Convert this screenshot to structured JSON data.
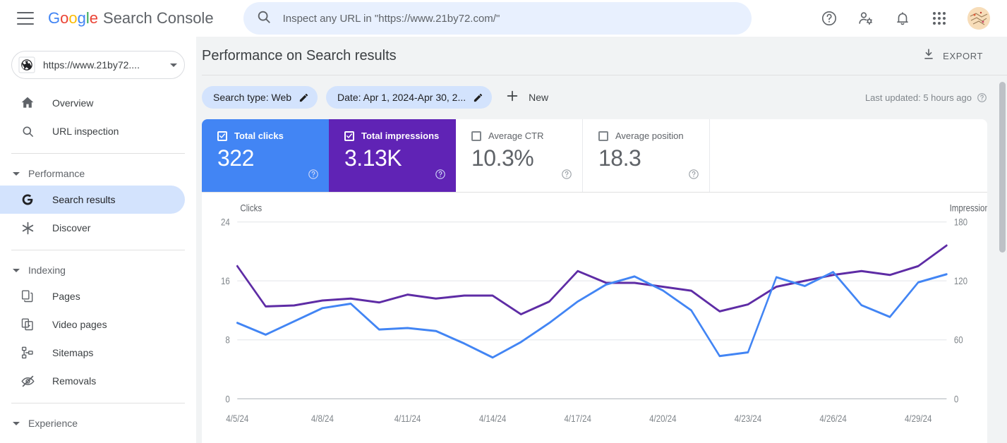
{
  "header": {
    "menu_icon": "hamburger-icon",
    "brand_google": [
      "G",
      "o",
      "o",
      "g",
      "l",
      "e"
    ],
    "brand_product": "Search Console",
    "search": {
      "icon": "search-icon",
      "placeholder": "Inspect any URL in \"https://www.21by72.com/\"",
      "value": ""
    },
    "icons": [
      {
        "name": "help-icon",
        "label": "Help"
      },
      {
        "name": "account-settings-icon",
        "label": "Account settings"
      },
      {
        "name": "notifications-bell-icon",
        "label": "Notifications"
      },
      {
        "name": "google-apps-grid-icon",
        "label": "Google apps"
      },
      {
        "name": "avatar",
        "label": "Account"
      }
    ]
  },
  "sidebar": {
    "property": {
      "icon": "site-property-icon",
      "label": "https://www.21by72....",
      "dropdown_icon": "chevron-down-icon"
    },
    "items": [
      {
        "name": "overview",
        "label": "Overview",
        "icon": "home-icon",
        "active": false
      },
      {
        "name": "url-inspection",
        "label": "URL inspection",
        "icon": "search-icon",
        "active": false
      }
    ],
    "groups": [
      {
        "name": "performance",
        "label": "Performance",
        "expanded": true,
        "items": [
          {
            "name": "search-results",
            "label": "Search results",
            "icon": "google-g-icon",
            "active": true
          },
          {
            "name": "discover",
            "label": "Discover",
            "icon": "discover-asterisk-icon",
            "active": false
          }
        ]
      },
      {
        "name": "indexing",
        "label": "Indexing",
        "expanded": true,
        "items": [
          {
            "name": "pages",
            "label": "Pages",
            "icon": "pages-copy-icon",
            "active": false
          },
          {
            "name": "video-pages",
            "label": "Video pages",
            "icon": "video-page-icon",
            "active": false
          },
          {
            "name": "sitemaps",
            "label": "Sitemaps",
            "icon": "sitemap-icon",
            "active": false
          },
          {
            "name": "removals",
            "label": "Removals",
            "icon": "eye-off-icon",
            "active": false
          }
        ]
      },
      {
        "name": "experience",
        "label": "Experience",
        "expanded": true,
        "items": []
      }
    ]
  },
  "main": {
    "page_title": "Performance on Search results",
    "export": {
      "label": "EXPORT",
      "icon": "download-icon"
    },
    "filters": [
      {
        "name": "search-type",
        "label": "Search type: Web",
        "edit_icon": "pencil-icon"
      },
      {
        "name": "date-range",
        "label": "Date: Apr 1, 2024-Apr 30, 2...",
        "edit_icon": "pencil-icon"
      }
    ],
    "new_filter": {
      "label": "New",
      "icon": "plus-icon"
    },
    "last_updated": {
      "label": "Last updated: 5 hours ago",
      "icon": "help-icon"
    },
    "metrics": [
      {
        "name": "total-clicks",
        "label": "Total clicks",
        "value": "322",
        "selected": true,
        "color": "#4285F4",
        "checkbox": "checked"
      },
      {
        "name": "total-impressions",
        "label": "Total impressions",
        "value": "3.13K",
        "selected": true,
        "color": "#6023b5",
        "checkbox": "checked"
      },
      {
        "name": "average-ctr",
        "label": "Average CTR",
        "value": "10.3%",
        "selected": false,
        "color": "#9aa0a6",
        "checkbox": "unchecked"
      },
      {
        "name": "average-position",
        "label": "Average position",
        "value": "18.3",
        "selected": false,
        "color": "#9aa0a6",
        "checkbox": "unchecked"
      }
    ]
  },
  "chart_data": {
    "type": "line",
    "title": "",
    "xlabel": "",
    "grid": true,
    "legend_position": "none",
    "x": [
      "4/5/24",
      "4/6/24",
      "4/7/24",
      "4/8/24",
      "4/9/24",
      "4/10/24",
      "4/11/24",
      "4/12/24",
      "4/13/24",
      "4/14/24",
      "4/15/24",
      "4/16/24",
      "4/17/24",
      "4/18/24",
      "4/19/24",
      "4/20/24",
      "4/21/24",
      "4/22/24",
      "4/23/24",
      "4/24/24",
      "4/25/24",
      "4/26/24",
      "4/27/24",
      "4/28/24",
      "4/29/24",
      "4/30/24"
    ],
    "x_tick_labels": [
      "4/5/24",
      "4/8/24",
      "4/11/24",
      "4/14/24",
      "4/17/24",
      "4/20/24",
      "4/23/24",
      "4/26/24",
      "4/29/24"
    ],
    "x_tick_indices": [
      0,
      3,
      6,
      9,
      12,
      15,
      18,
      21,
      24
    ],
    "axes": [
      {
        "name": "clicks-axis",
        "side": "left",
        "label": "Clicks",
        "ticks": [
          0,
          8,
          16,
          24
        ],
        "min": 0,
        "max": 24
      },
      {
        "name": "impressions-axis",
        "side": "right",
        "label": "Impressions",
        "ticks": [
          0,
          60,
          120,
          180
        ],
        "min": 0,
        "max": 180
      }
    ],
    "series": [
      {
        "name": "Total clicks",
        "axis": "left",
        "color": "#4285F4",
        "values": [
          10.3,
          8.7,
          10.5,
          12.3,
          12.9,
          9.4,
          9.6,
          9.2,
          7.5,
          5.6,
          7.7,
          10.3,
          13.2,
          15.5,
          16.6,
          14.7,
          12.0,
          5.8,
          6.3,
          16.5,
          15.3,
          17.2,
          12.7,
          11.1,
          15.8,
          16.9
        ]
      },
      {
        "name": "Total impressions",
        "axis": "right",
        "color": "#5e2ca5",
        "values": [
          135,
          94,
          95,
          100,
          102,
          98,
          106,
          102,
          105,
          105,
          86,
          99,
          130,
          118,
          118,
          114,
          110,
          89,
          96,
          114,
          120,
          126,
          130,
          126,
          135,
          156
        ]
      }
    ]
  }
}
